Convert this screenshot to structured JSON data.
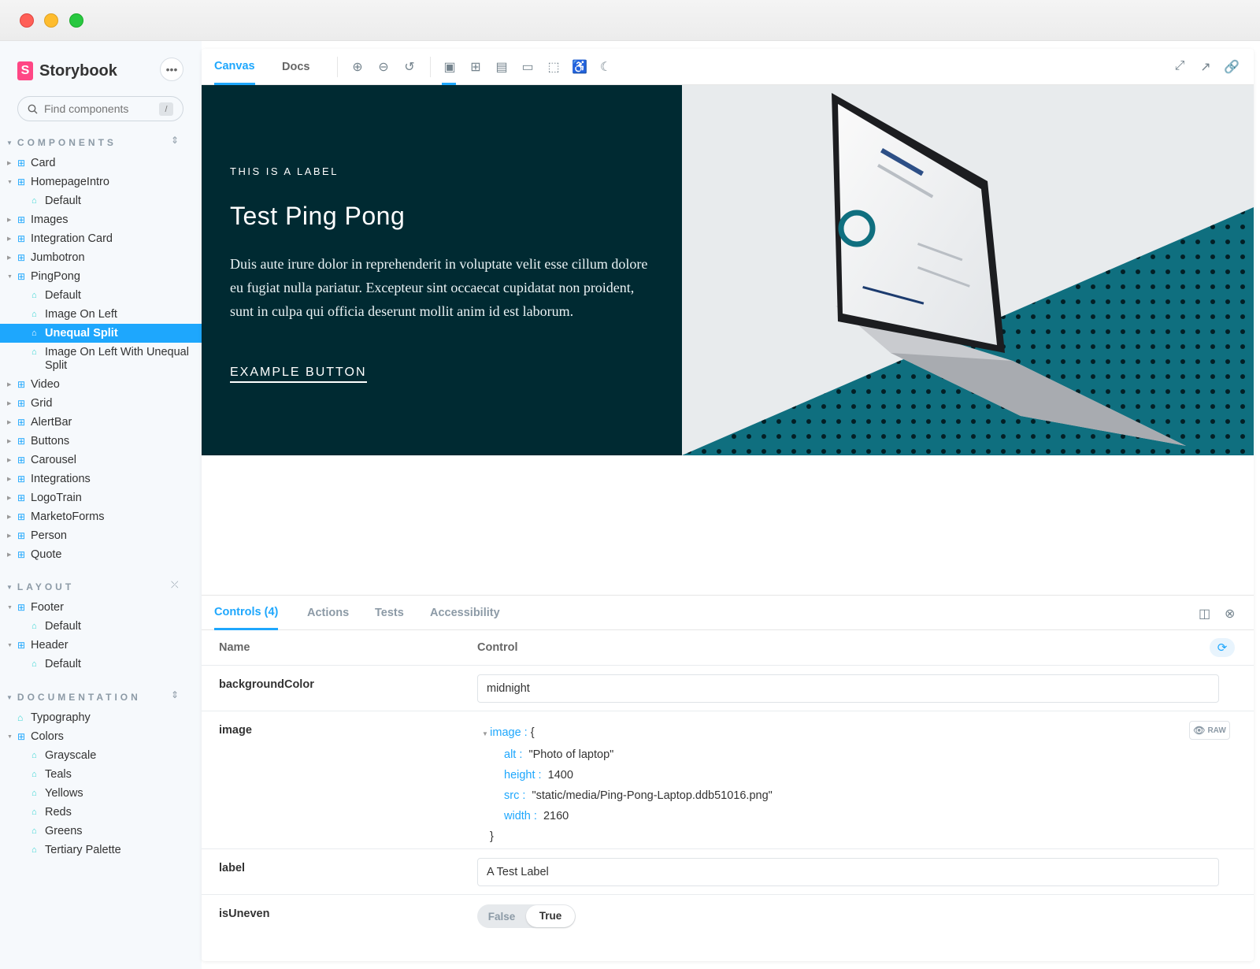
{
  "brand": {
    "name": "Storybook",
    "logo_letter": "S"
  },
  "search": {
    "placeholder": "Find components",
    "shortcut": "/"
  },
  "sections": {
    "components": "COMPONENTS",
    "layout": "LAYOUT",
    "documentation": "DOCUMENTATION"
  },
  "tree": {
    "card": "Card",
    "homepage_intro": "HomepageIntro",
    "homepage_default": "Default",
    "images": "Images",
    "integration_card": "Integration Card",
    "jumbotron": "Jumbotron",
    "pingpong": "PingPong",
    "pp_default": "Default",
    "pp_image_on_left": "Image On Left",
    "pp_unequal_split": "Unequal Split",
    "pp_image_on_left_unequal": "Image On Left With Unequal Split",
    "video": "Video",
    "grid": "Grid",
    "alertbar": "AlertBar",
    "buttons": "Buttons",
    "carousel": "Carousel",
    "integrations": "Integrations",
    "logotrain": "LogoTrain",
    "marketoforms": "MarketoForms",
    "person": "Person",
    "quote": "Quote",
    "footer": "Footer",
    "footer_default": "Default",
    "header": "Header",
    "header_default": "Default",
    "typography": "Typography",
    "colors": "Colors",
    "grayscale": "Grayscale",
    "teals": "Teals",
    "yellows": "Yellows",
    "reds": "Reds",
    "greens": "Greens",
    "tertiary": "Tertiary Palette"
  },
  "toolbar": {
    "canvas": "Canvas",
    "docs": "Docs"
  },
  "hero": {
    "label": "THIS IS A LABEL",
    "title": "Test Ping Pong",
    "body": "Duis aute irure dolor in reprehenderit in voluptate velit esse cillum dolore eu fugiat nulla pariatur. Excepteur sint occaecat cupidatat non proident, sunt in culpa qui officia deserunt mollit anim id est laborum.",
    "button": "EXAMPLE BUTTON"
  },
  "addons": {
    "tabs": [
      "Controls (4)",
      "Actions",
      "Tests",
      "Accessibility"
    ],
    "col_name": "Name",
    "col_control": "Control"
  },
  "controls": {
    "bg_name": "backgroundColor",
    "bg_value": "midnight",
    "image_name": "image",
    "image_key": "image :",
    "image_open": "{",
    "alt_key": "alt :",
    "alt_val": "\"Photo of laptop\"",
    "height_key": "height :",
    "height_val": "1400",
    "src_key": "src :",
    "src_val": "\"static/media/Ping-Pong-Laptop.ddb51016.png\"",
    "width_key": "width :",
    "width_val": "2160",
    "image_close": "}",
    "raw": "RAW",
    "label_name": "label",
    "label_value": "A Test Label",
    "uneven_name": "isUneven",
    "false_opt": "False",
    "true_opt": "True"
  },
  "colors": {
    "accent": "#1ea7fd",
    "hero_bg": "#002a32",
    "teal": "#0f6f7f",
    "brand": "#ff4785"
  }
}
